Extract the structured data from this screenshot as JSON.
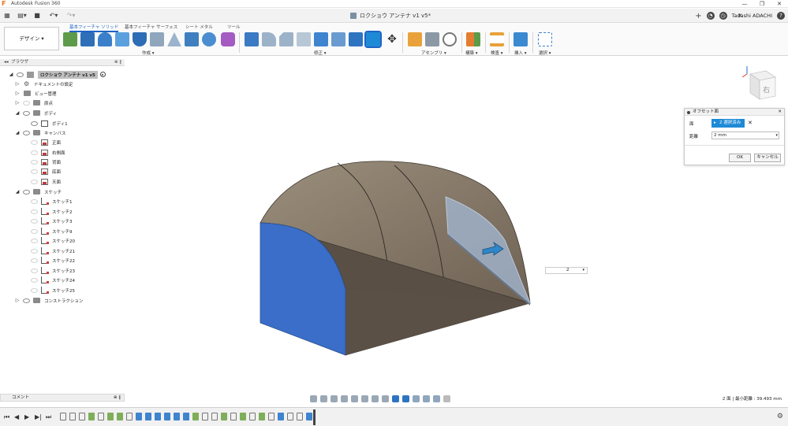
{
  "title_bar": {
    "app_title": "Autodesk Fusion 360",
    "controls": [
      "—",
      "❐",
      "✕"
    ]
  },
  "quick_access": {
    "doc_title": "ロクショウ アンテナ v1 v5*",
    "user_name": "Tadashi ADACHI",
    "help": "?"
  },
  "toolbar": {
    "workspace": "デザイン ▾",
    "tabs": [
      "基本フィーチャ ソリッド",
      "基本フィーチャ サーフェス",
      "シート メタル",
      "ツール"
    ],
    "groups": [
      "作成 ▾",
      "修正 ▾",
      "アセンブリ ▾",
      "構築 ▾",
      "検査 ▾",
      "挿入 ▾",
      "選択 ▾"
    ]
  },
  "browser": {
    "header": "ブラウザ",
    "controls": "⊕ ‖",
    "rows": [
      {
        "label": "ロクショウ アンテナ v1 v5"
      },
      {
        "label": "ドキュメントの設定"
      },
      {
        "label": "ビュー管理"
      },
      {
        "label": "原点"
      },
      {
        "label": "ボディ"
      },
      {
        "label": "ボディ1"
      },
      {
        "label": "キャンバス"
      },
      {
        "label": "正面"
      },
      {
        "label": "右側面"
      },
      {
        "label": "背面"
      },
      {
        "label": "底面"
      },
      {
        "label": "天面"
      },
      {
        "label": "スケッチ"
      },
      {
        "label": "スケッチ1"
      },
      {
        "label": "スケッチ2"
      },
      {
        "label": "スケッチ3"
      },
      {
        "label": "スケッチ9"
      },
      {
        "label": "スケッチ20"
      },
      {
        "label": "スケッチ21"
      },
      {
        "label": "スケッチ22"
      },
      {
        "label": "スケッチ23"
      },
      {
        "label": "スケッチ24"
      },
      {
        "label": "スケッチ25"
      },
      {
        "label": "コンストラクション"
      }
    ]
  },
  "dialog": {
    "title": "オフセット面",
    "close": "✕",
    "face_label": "面",
    "face_selection": "2 選択済み",
    "clear": "✕",
    "distance_label": "距離",
    "distance_value": "2 mm",
    "ok": "OK",
    "cancel": "キャンセル"
  },
  "viewcube": {
    "face_label": "右"
  },
  "canvas": {
    "value_input": "2"
  },
  "comments": {
    "label": "コメント",
    "controls": "⊕ ‖"
  },
  "status": {
    "text": "2 面 | 最小距離 : 39.493 mm"
  },
  "colors": {
    "accent": "#1e8ad6",
    "selected_face": "#3a6ec8",
    "body_top": "#8b7d6b",
    "body_front": "#5a4f44"
  }
}
